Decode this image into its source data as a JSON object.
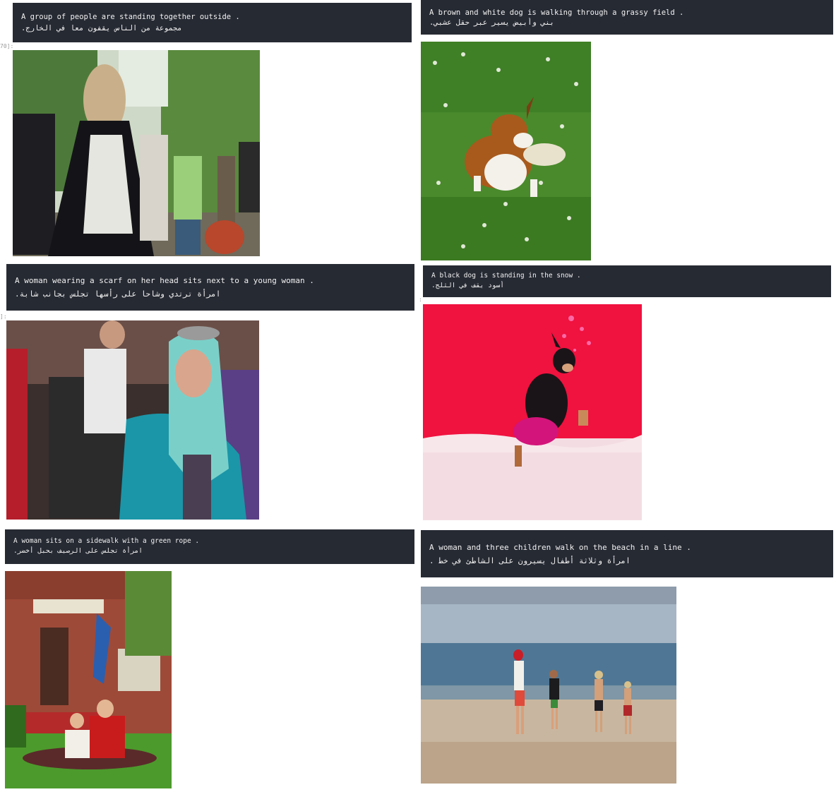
{
  "cell_labels": {
    "c1": "70]:",
    "c3": "]:",
    "c4": ":"
  },
  "cards": [
    {
      "caption_en": "A group of people are standing together outside .",
      "caption_ar": "مجموعة من الناس يقفون معا في الخارج."
    },
    {
      "caption_en": "A brown and white dog is walking through a grassy field .",
      "caption_ar": "بني وأبيض يسير عبر حقل عشبي."
    },
    {
      "caption_en": "A woman wearing a scarf on her head sits next to a young woman .",
      "caption_ar": "امرأة ترتدي وشاحا على رأسها تجلس بجانب شابة."
    },
    {
      "caption_en": "A black dog is standing in the snow .",
      "caption_ar": "أسود يقف في الثلج."
    },
    {
      "caption_en": "A woman sits on a sidewalk with a green rope .",
      "caption_ar": "امرأة تجلس على الرصيف بحبل أخضر."
    },
    {
      "caption_en": "A woman and three children walk on the beach in a line .",
      "caption_ar": "امرأة وثلاثة أطفال يسيرون على الشاطئ في خط ."
    }
  ]
}
